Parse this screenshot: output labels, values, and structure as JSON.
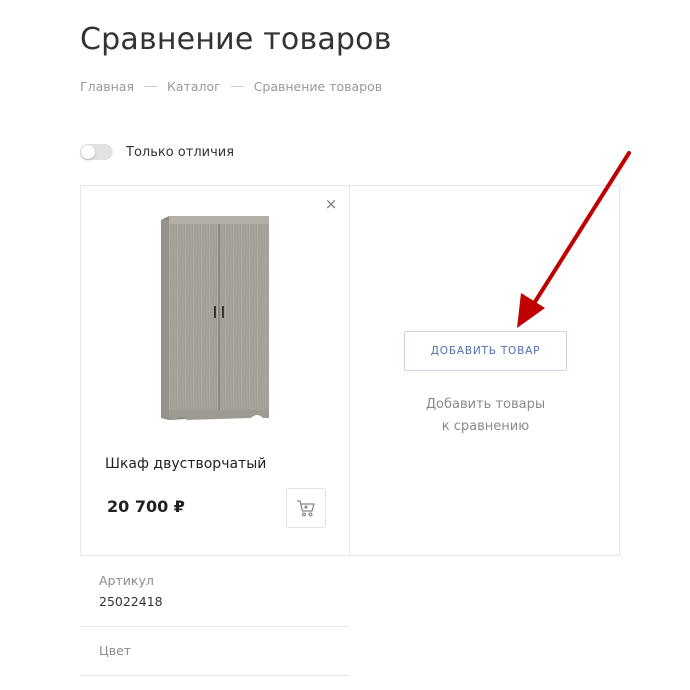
{
  "page": {
    "title": "Сравнение товаров"
  },
  "breadcrumb": {
    "items": [
      "Главная",
      "Каталог",
      "Сравнение товаров"
    ]
  },
  "filter": {
    "differences_only_label": "Только отличия",
    "enabled": false
  },
  "product": {
    "name": "Шкаф двустворчатый",
    "price": "20 700 ₽",
    "remove_symbol": "×"
  },
  "add_slot": {
    "button_label": "ДОБАВИТЬ ТОВАР",
    "hint_line1": "Добавить товары",
    "hint_line2": "к сравнению"
  },
  "properties": [
    {
      "label": "Артикул",
      "value": "25022418"
    },
    {
      "label": "Цвет",
      "value": ""
    }
  ],
  "colors": {
    "accent_blue": "#4e6fae",
    "annotation_arrow": "#c00000"
  },
  "icons": {
    "remove": "close-icon",
    "cart": "cart-icon"
  }
}
